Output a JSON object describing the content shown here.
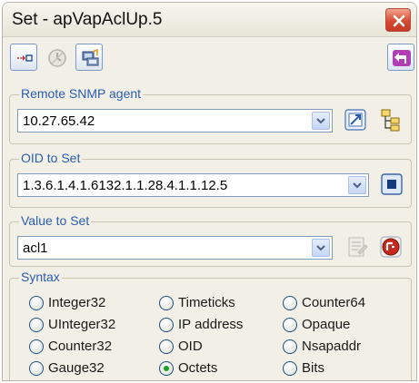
{
  "window": {
    "title": "Set - apVapAclUp.5"
  },
  "toolbar": {
    "buttons": [
      {
        "icon": "set-arrow-icon"
      },
      {
        "icon": "disabled-clock-icon"
      },
      {
        "icon": "computer-icon"
      },
      {
        "icon": "purple-arrow-icon"
      }
    ]
  },
  "agent": {
    "label": "Remote SNMP agent",
    "value": "10.27.65.42"
  },
  "oid": {
    "label": "OID to Set",
    "value": "1.3.6.1.4.1.6132.1.1.28.4.1.1.12.5"
  },
  "value": {
    "label": "Value to Set",
    "value": "acl1"
  },
  "syntax": {
    "label": "Syntax",
    "selected": "Octets",
    "options": [
      [
        "Integer32",
        "Timeticks",
        "Counter64"
      ],
      [
        "UInteger32",
        "IP address",
        "Opaque"
      ],
      [
        "Counter32",
        "OID",
        "Nsapaddr"
      ],
      [
        "Gauge32",
        "Octets",
        "Bits"
      ]
    ]
  },
  "colors": {
    "window_bg": "#f1efe6",
    "group_label": "#2a5db0",
    "close": "#d64a33",
    "radio_checked": "#21a121"
  }
}
